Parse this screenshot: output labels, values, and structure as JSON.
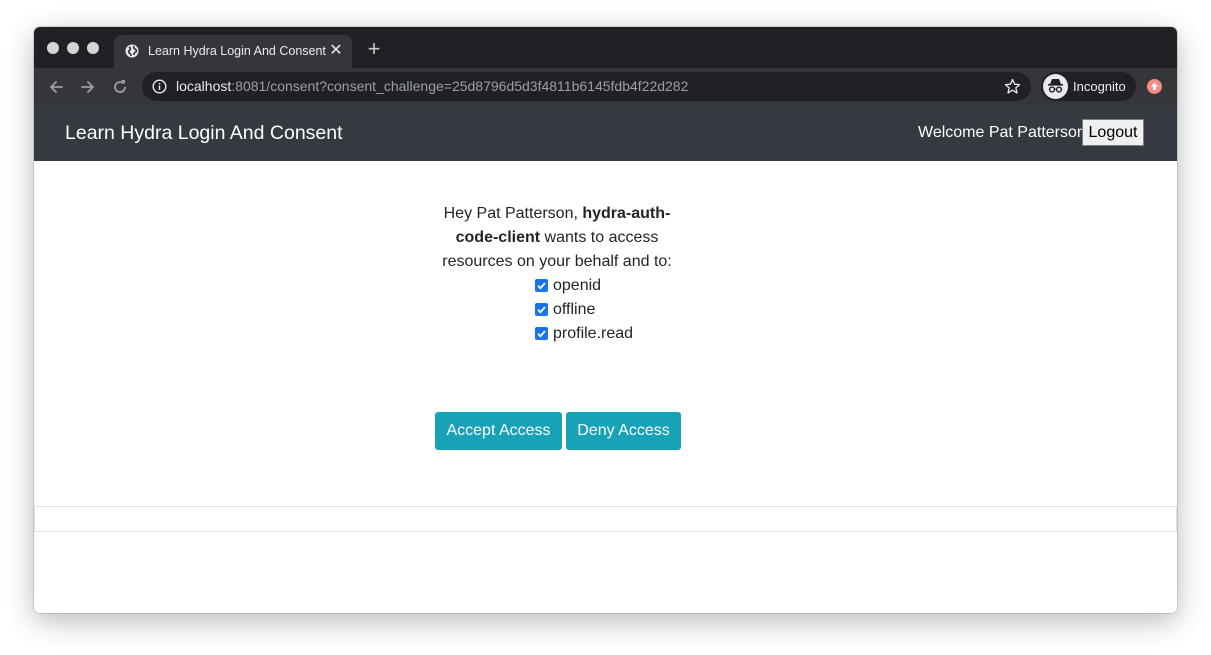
{
  "browser": {
    "tab_title": "Learn Hydra Login And Consent",
    "tab_close": "✕",
    "new_tab": "+",
    "url_host": "localhost",
    "url_rest": ":8081/consent?consent_challenge=25d8796d5d3f4811b6145fdb4f22d282",
    "profile_label": "Incognito"
  },
  "navbar": {
    "brand": "Learn Hydra Login And Consent",
    "welcome": "Welcome Pat Patterson",
    "logout_label": "Logout"
  },
  "consent": {
    "greeting": "Hey Pat Patterson, ",
    "client_name": "hydra-auth-code-client",
    "request_text": " wants to access resources on your behalf and to:",
    "scopes": [
      {
        "label": "openid",
        "checked": true
      },
      {
        "label": "offline",
        "checked": true
      },
      {
        "label": "profile.read",
        "checked": true
      }
    ],
    "accept_label": "Accept Access",
    "deny_label": "Deny Access"
  },
  "colors": {
    "navbar_bg": "#343a40",
    "button_bg": "#17a2b8",
    "checkbox": "#1a73e8"
  }
}
